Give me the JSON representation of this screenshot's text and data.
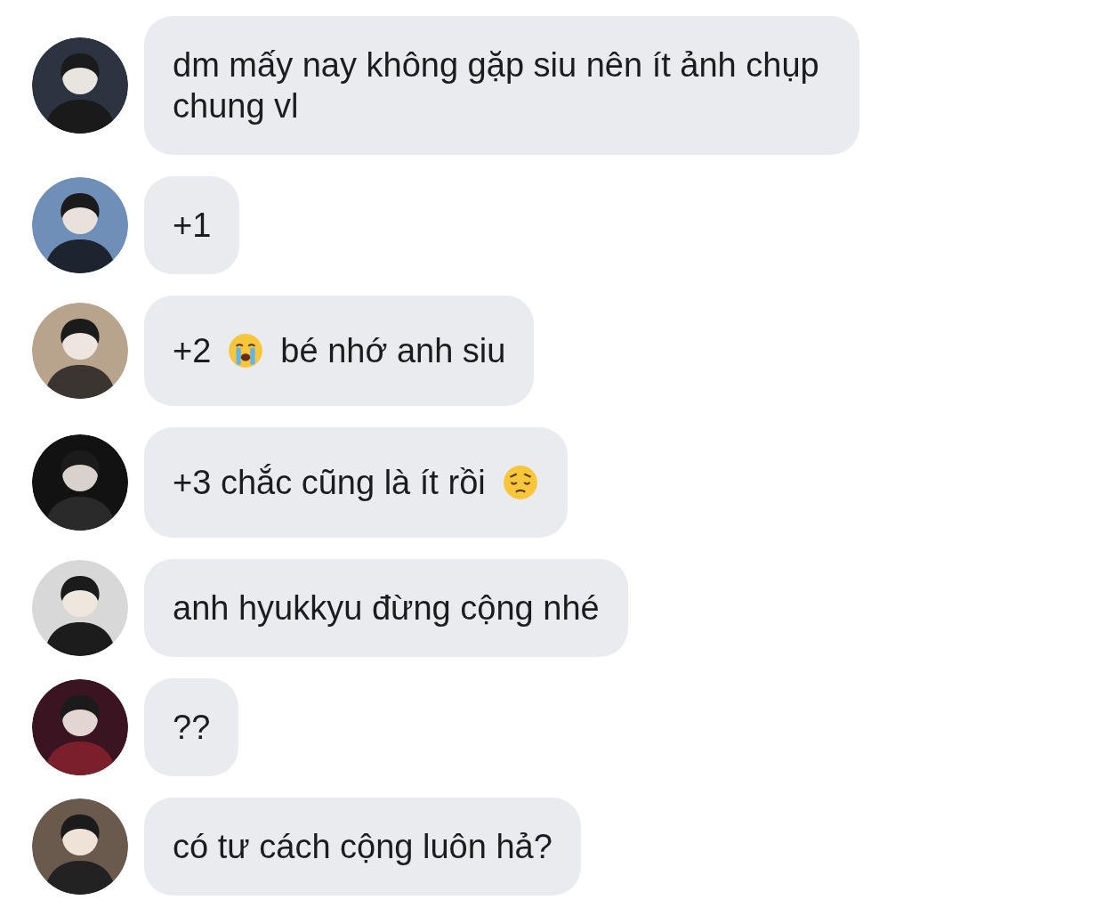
{
  "messages": [
    {
      "parts": [
        {
          "kind": "text",
          "text": "dm mấy nay không gặp siu nên ít ảnh chụp chung vl"
        }
      ]
    },
    {
      "parts": [
        {
          "kind": "text",
          "text": "+1"
        }
      ]
    },
    {
      "parts": [
        {
          "kind": "text",
          "text": "+2"
        },
        {
          "kind": "crying-emoji"
        },
        {
          "kind": "text",
          "text": "bé nhớ anh siu"
        }
      ]
    },
    {
      "parts": [
        {
          "kind": "text",
          "text": "+3 chắc cũng là ít rồi"
        },
        {
          "kind": "pensive-emoji"
        }
      ]
    },
    {
      "parts": [
        {
          "kind": "text",
          "text": "anh hyukkyu đừng cộng nhé"
        }
      ]
    },
    {
      "parts": [
        {
          "kind": "text",
          "text": "??"
        }
      ]
    },
    {
      "parts": [
        {
          "kind": "text",
          "text": "có tư cách cộng luôn hả?"
        }
      ]
    }
  ]
}
